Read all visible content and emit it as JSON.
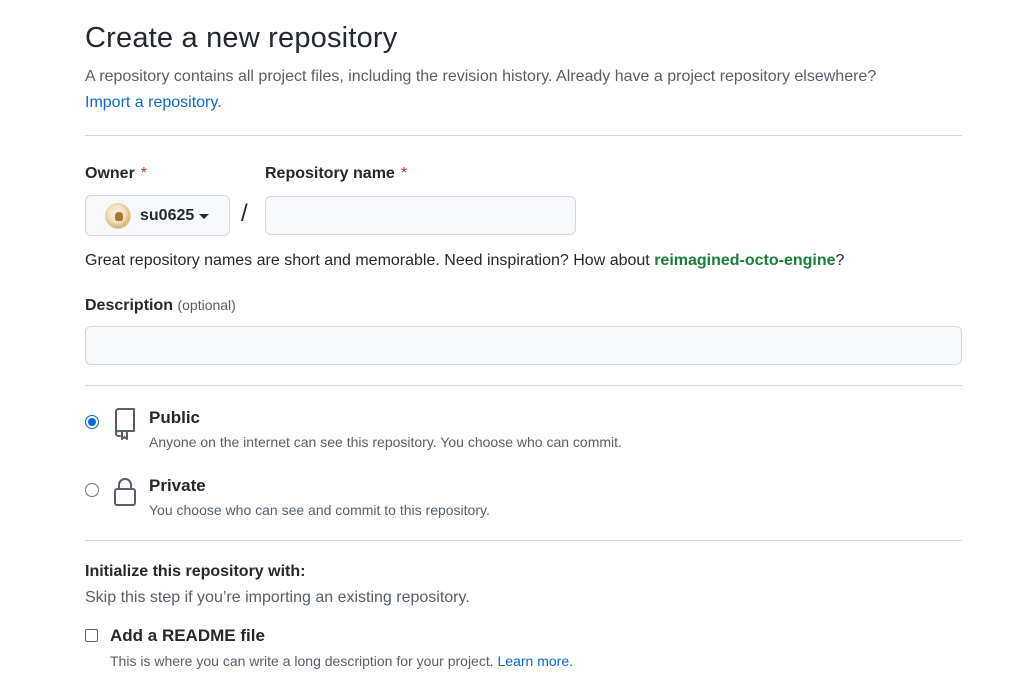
{
  "header": {
    "title": "Create a new repository",
    "subtitle": "A repository contains all project files, including the revision history. Already have a project repository elsewhere?",
    "import_link": "Import a repository."
  },
  "owner": {
    "label": "Owner",
    "required_mark": "*",
    "selected": "su0625",
    "avatar": "user-avatar"
  },
  "separator": "/",
  "repo_name": {
    "label": "Repository name",
    "required_mark": "*",
    "value": "",
    "placeholder": ""
  },
  "name_hint": {
    "text": "Great repository names are short and memorable. Need inspiration? How about",
    "suggestion": "reimagined-octo-engine",
    "suffix": "?"
  },
  "description": {
    "label": "Description",
    "optional": "(optional)",
    "value": "",
    "placeholder": ""
  },
  "visibility": {
    "options": [
      {
        "title": "Public",
        "description": "Anyone on the internet can see this repository. You choose who can commit.",
        "icon": "repo-icon",
        "selected": true
      },
      {
        "title": "Private",
        "description": "You choose who can see and commit to this repository.",
        "icon": "lock-icon",
        "selected": false
      }
    ]
  },
  "initialize": {
    "title": "Initialize this repository with:",
    "subtitle": "Skip this step if you’re importing an existing repository.",
    "readme": {
      "label": "Add a README file",
      "description": "This is where you can write a long description for your project.",
      "learn_more": "Learn more.",
      "checked": false
    }
  },
  "colors": {
    "accent": "#0969da",
    "required": "#cf222e",
    "suggestion": "#1a7f37",
    "border": "#d0d7de",
    "input_bg": "#f6f8fa"
  }
}
